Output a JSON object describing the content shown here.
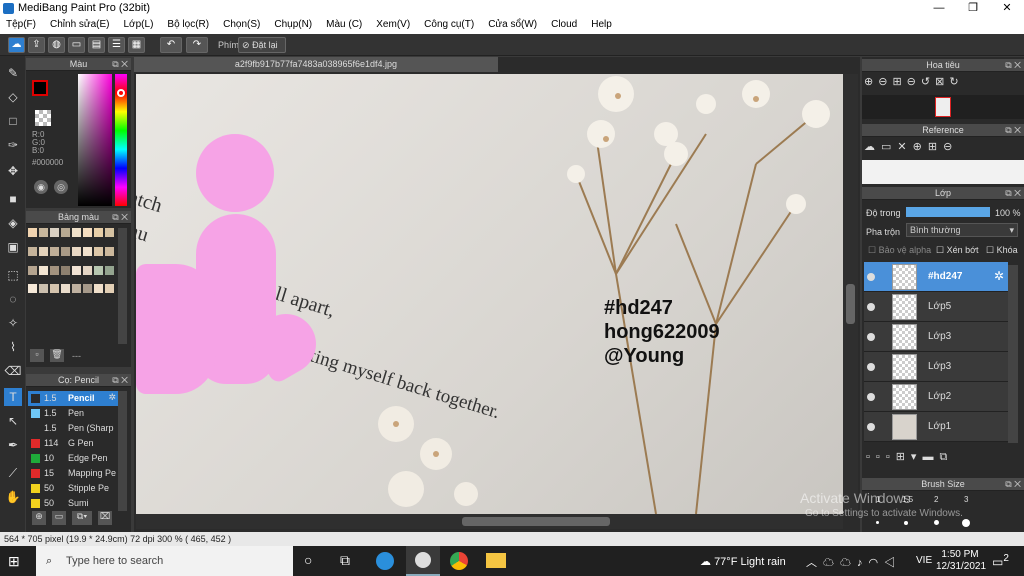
{
  "window": {
    "title": "MediBang Paint Pro (32bit)",
    "minimize": "—",
    "maximize": "❐",
    "close": "✕"
  },
  "menu": [
    "Tệp(F)",
    "Chỉnh sửa(E)",
    "Lớp(L)",
    "Bộ lọc(R)",
    "Chọn(S)",
    "Chụp(N)",
    "Màu (C)",
    "Xem(V)",
    "Công cụ(T)",
    "Cửa sổ(W)",
    "Cloud",
    "Help"
  ],
  "toolbar": {
    "phim_label": "Phím",
    "reset_label": "Đặt lại"
  },
  "document": {
    "filename": "a2f9fb917b77fa7483a038965f6e1df4.jpg"
  },
  "panels": {
    "color": {
      "title": "Màu",
      "r": "R:0",
      "g": "G:0",
      "b": "B:0",
      "hex": "#000000"
    },
    "palette": {
      "title": "Bảng màu",
      "dashes": "---"
    },
    "brush": {
      "title": "Cọ: Pencil",
      "items": [
        {
          "size": "1.5",
          "name": "Pencil",
          "color": "#2a2a2a",
          "selected": true
        },
        {
          "size": "1.5",
          "name": "Pen",
          "color": "#6fc7f5"
        },
        {
          "size": "1.5",
          "name": "Pen (Sharp",
          "color": "#2a2a2a"
        },
        {
          "size": "114",
          "name": "G Pen",
          "color": "#e22a2a"
        },
        {
          "size": "10",
          "name": "Edge Pen",
          "color": "#1faa3a"
        },
        {
          "size": "15",
          "name": "Mapping Pe",
          "color": "#e22a2a"
        },
        {
          "size": "50",
          "name": "Stipple Pe",
          "color": "#f2d21e"
        },
        {
          "size": "50",
          "name": "Sumi",
          "color": "#f2d21e"
        }
      ]
    },
    "navigator": {
      "title": "Hoa tiêu"
    },
    "reference": {
      "title": "Reference"
    },
    "layer": {
      "title": "Lớp",
      "opacity_label": "Độ trong",
      "opacity_value": "100 %",
      "blend_label": "Pha trộn",
      "blend_value": "Bình thường",
      "protect_alpha": "Bảo vệ alpha",
      "clip": "Xén bớt",
      "lock": "Khóa",
      "layers": [
        {
          "name": "#hd247",
          "selected": true
        },
        {
          "name": "Lớp5"
        },
        {
          "name": "Lớp3"
        },
        {
          "name": "Lớp3"
        },
        {
          "name": "Lớp2"
        },
        {
          "name": "Lớp1"
        }
      ]
    },
    "brushsize": {
      "title": "Brush Size",
      "sizes": [
        "1",
        "1.5",
        "2",
        "3"
      ]
    }
  },
  "canvas_text": {
    "line1": "#hd247",
    "line2": "hong622009",
    "line3": "@Young",
    "book1": "watch",
    "book2": "self fall apart,",
    "book3": "camu",
    "book4": "ly ne putting myself back together."
  },
  "watermark": {
    "line1": "Activate Windows",
    "line2": "Go to Settings to activate Windows."
  },
  "status": {
    "text": "564 * 705 pixel   (19.9 * 24.9cm)   72 dpi   300 %   ( 465, 452 )"
  },
  "taskbar": {
    "search_placeholder": "Type here to search",
    "weather": "77°F  Light rain",
    "lang": "VIE",
    "time": "1:50 PM",
    "date": "12/31/2021",
    "notif": "2"
  }
}
